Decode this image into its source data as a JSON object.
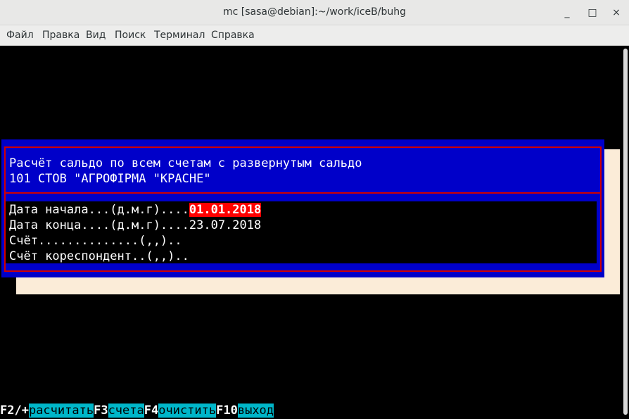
{
  "window": {
    "title": "mc [sasa@debian]:~/work/iceB/buhg",
    "buttons": {
      "minimize": "_",
      "maximize": "□",
      "close": "×"
    }
  },
  "menu": [
    "Файл",
    "Правка",
    "Вид",
    "Поиск",
    "Терминал",
    "Справка"
  ],
  "dialog": {
    "title_line1": "Расчёт сальдо по всем счетам с развернутым сальдо",
    "title_line2": "101 СТОВ \"АГРОФІРМА \"КРАСНЕ\"",
    "fields": [
      {
        "label": "Дата начала...(д.м.г)....",
        "value": "01.01.2018"
      },
      {
        "label": "Дата конца....(д.м.г)....",
        "value": "23.07.2018"
      },
      {
        "label": "Счёт..............(,,)..",
        "value": ""
      },
      {
        "label": "Счёт кореспондент..(,,)..",
        "value": ""
      }
    ]
  },
  "function_keys": [
    {
      "key": "F2/+",
      "label": "расчитать"
    },
    {
      "key": "F3",
      "label": "счета"
    },
    {
      "key": "F4",
      "label": "очистить"
    },
    {
      "key": "F10",
      "label": "выход"
    }
  ],
  "colors": {
    "dialog_bg": "#0000c9",
    "frame": "#d00000",
    "highlight": "#ff0000",
    "fkey_label_bg": "#00b6c9",
    "shadow": "#fbecd8"
  }
}
